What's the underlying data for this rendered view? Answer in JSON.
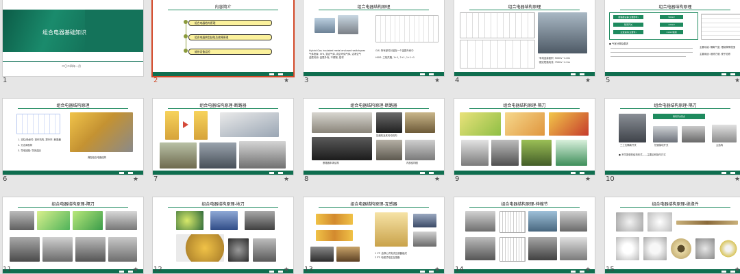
{
  "slides": [
    {
      "number": "1",
      "cover_title": "组合电器基础知识",
      "cover_date": "二〇二四年一月",
      "starred": false
    },
    {
      "number": "2",
      "title": "内容简介",
      "items": [
        "组合电器结构原理",
        "组合电器典型缺陷及故障原理",
        "维修设备运检"
      ],
      "starred": true
    },
    {
      "number": "3",
      "title": "组合电器结构原理",
      "text_a": "Hybrid Gas insulated metal enclosed switchgear",
      "text_b": "气体绝缘: SF6, 混合气体, 真空环保气体, 洁净空气",
      "text_c": "金属封闭: 金属外壳, 不锈钢, 铝材",
      "text_d": "GIS: 所有部件封装在一个金属外壳中",
      "text_e": "HGIS: 三相共箱, 1+1, 2+1, 1+1+1",
      "starred": true
    },
    {
      "number": "4",
      "title": "组合电器结构原理",
      "text_a": "· 导电连接面积: 500kV~4.6m",
      "text_b": "· 额定短路电流: 750kV~4.5m",
      "starred": true
    },
    {
      "number": "5",
      "title": "组合电器结构原理",
      "boxes": [
        "断路器设备(主要部件)",
        "隔离开关",
        "主变进线(主要件)",
        "500kV",
        "220kV",
        "110kV级别"
      ],
      "text_a": "● 气室分隔及要求",
      "text_b": "主要功能: 隔离气室, 限制故障范围",
      "text_c": "主要用途: 维修方便, 便于检修",
      "starred": true
    },
    {
      "number": "6",
      "title": "组合电器结构原理",
      "text_a": "1. 支柱/绝缘件: 操作机构, 提升杆, 断路器",
      "text_b": "2. 分合闸机构",
      "text_c": "3. 导电回路: 导体连接",
      "caption": "典型组合电器结构",
      "starred": true
    },
    {
      "number": "7",
      "title": "组合电器结构原理-断路器",
      "starred": true
    },
    {
      "number": "8",
      "title": "组合电器结构原理-断路器",
      "caption_a": "压缩机及其传动机构",
      "caption_b": "断路器本体结构",
      "caption_c": "内部结构图",
      "starred": true
    },
    {
      "number": "9",
      "title": "组合电器结构原理-隔刀",
      "starred": true
    },
    {
      "number": "10",
      "title": "组合电器结构原理-隔刀",
      "banner": "隔离开关形式",
      "caption_a": "三工位隔离开关",
      "caption_b": "快速接地开关",
      "caption_c": "主结构",
      "text_a": "● 不同类型的结构形式——主要区别操作方式",
      "starred": true
    },
    {
      "number": "11",
      "title": "组合电器结构原理-隔刀",
      "starred": true
    },
    {
      "number": "12",
      "title": "组合电器结构原理-地刀",
      "starred": true
    },
    {
      "number": "13",
      "title": "组合电器结构原理-互感器",
      "text_a": "1 CT: 由穿心式电流互感器组成",
      "text_b": "2 PT: 电磁式电压互感器",
      "starred": true
    },
    {
      "number": "14",
      "title": "组合电器结构原理-伸缩节",
      "starred": true
    },
    {
      "number": "15",
      "title": "组合电器结构原理-绝缘件",
      "starred": true
    }
  ],
  "colors": {
    "accent": "#0f6e4f",
    "selection": "#d24726",
    "panel_bg": "#e6e6e6",
    "bullet_fill": "#fbf19c"
  },
  "star_glyph": "★"
}
